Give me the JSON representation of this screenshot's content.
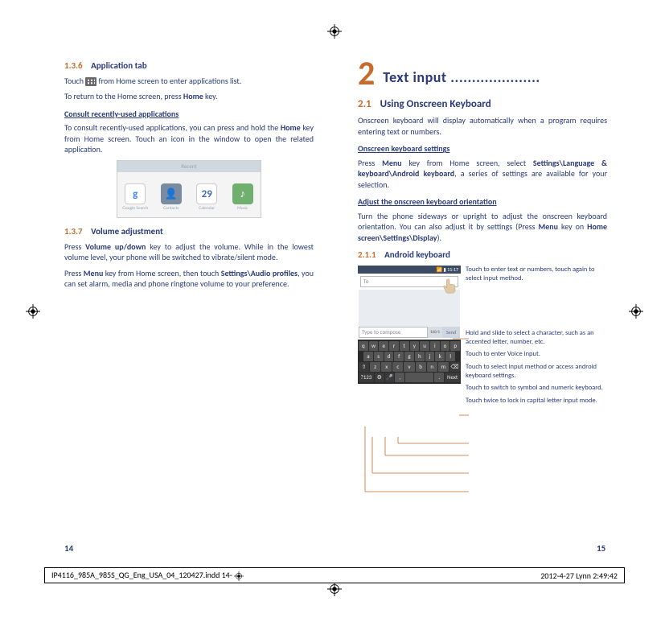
{
  "left": {
    "s136_num": "1.3.6",
    "s136_title": "Application tab",
    "s136_p1a": "Touch ",
    "s136_p1b": " from Home screen to enter applications list.",
    "s136_p2": "To return to the Home screen, press Home key.",
    "s136_h_recent": "Consult recently-used applications",
    "s136_p3": "To consult recently-used applications, you can press and hold the Home key from Home screen. Touch an icon in the window to open the related application.",
    "recent_bar": "Recent",
    "recent_apps": [
      {
        "label": "Google Search",
        "glyph": "g",
        "bg": "#ffffff",
        "fg": "#4285F4",
        "border": "1px solid #ccc"
      },
      {
        "label": "Contacts",
        "glyph": "👤",
        "bg": "#7a8aa0",
        "fg": "#fff",
        "border": "none"
      },
      {
        "label": "Calendar",
        "glyph": "29",
        "bg": "#ffffff",
        "fg": "#4568b2",
        "border": "1px solid #ccc"
      },
      {
        "label": "Music",
        "glyph": "♪",
        "bg": "#6fb06f",
        "fg": "#fff",
        "border": "none"
      }
    ],
    "s137_num": "1.3.7",
    "s137_title": "Volume adjustment",
    "s137_p1": "Press Volume up/down key to adjust the volume. While in the lowest volume level, your phone will be switched to vibrate/silent mode.",
    "s137_p2": "Press Menu key from Home screen, then touch Settings\\Audio profiles, you can set alarm, media and phone ringtone volume to your preference.",
    "page_num": "14"
  },
  "right": {
    "chap_num": "2",
    "chap_title": "Text input .....................",
    "s21_num": "2.1",
    "s21_title": "Using Onscreen Keyboard",
    "s21_p1": "Onscreen keyboard will display automatically when a program requires entering text or numbers.",
    "h_settings": "Onscreen keyboard settings",
    "p_settings": "Press Menu key from Home screen, select Settings\\Language & keyboard\\Android keyboard, a series of settings are available for your selection.",
    "h_orient": "Adjust the onscreen keyboard orientation",
    "p_orient": "Turn the phone sideways or upright to adjust the onscreen keyboard orientation. You can also adjust it by settings (Press Menu key on Home screen\\Settings\\Display).",
    "s211_num": "2.1.1",
    "s211_title": "Android keyboard",
    "status_time": "11:17",
    "to_label": "To",
    "compose_placeholder": "Type to compose",
    "compose_count": "160/1",
    "send_label": "Send",
    "kb_rows": [
      [
        "q",
        "w",
        "e",
        "r",
        "t",
        "y",
        "u",
        "i",
        "o",
        "p"
      ],
      [
        "a",
        "s",
        "d",
        "f",
        "g",
        "h",
        "j",
        "k",
        "l"
      ],
      [
        "⇧",
        "z",
        "x",
        "c",
        "v",
        "b",
        "n",
        "m",
        "⌫"
      ],
      [
        "?123",
        "⚙",
        "🎤",
        " , ",
        " ",
        ".",
        "Next"
      ]
    ],
    "callouts": [
      "Touch to enter text or numbers, touch again to select input method.",
      "Hold and slide to select a character, such as an accented letter, number, etc.",
      "Touch to enter Voice input.",
      "Touch to select input method or access android keyboard settings.",
      "Touch to switch to symbol and numeric keyboard.",
      "Touch twice to lock in capital letter input mode."
    ],
    "page_num": "15"
  },
  "footer": {
    "file": "IP4116_985A_985S_QG_Eng_USA_04_120427.indd   14-",
    "date": "2012-4-27   Lynn 2:49:42"
  }
}
